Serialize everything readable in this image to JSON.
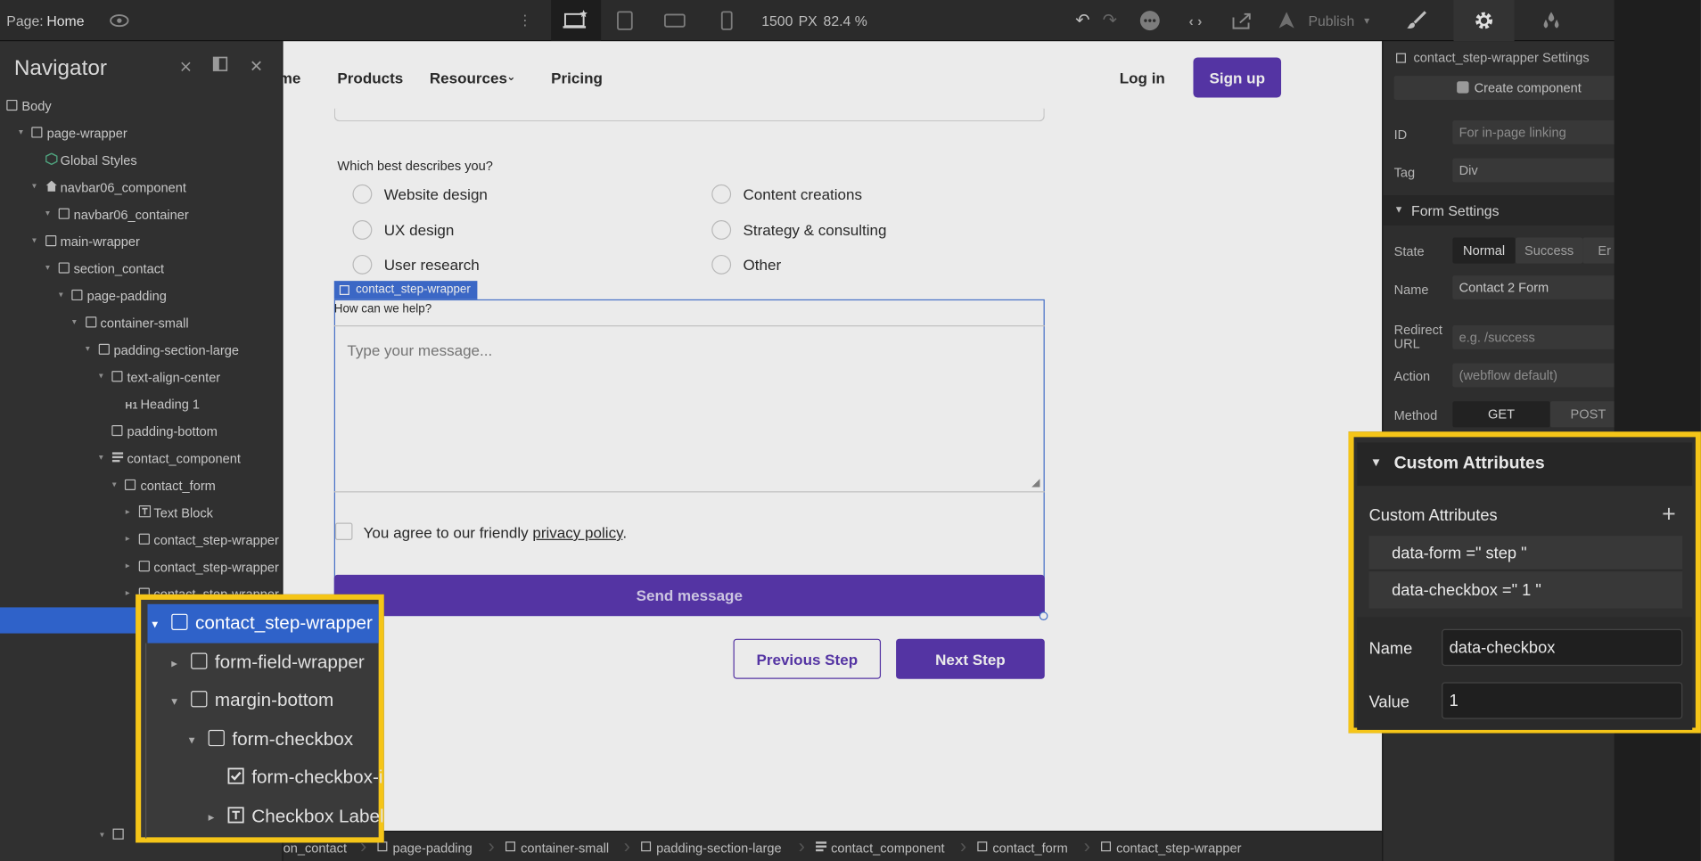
{
  "topbar": {
    "page_label": "Page:",
    "page_name": "Home",
    "width_value": "1500",
    "width_unit": "PX",
    "zoom": "82.4 %",
    "publish": "Publish"
  },
  "navigator": {
    "title": "Navigator",
    "tree": [
      {
        "label": "Body",
        "depth": 0,
        "arrow": false,
        "icon": "box"
      },
      {
        "label": "page-wrapper",
        "depth": 1,
        "arrow": true,
        "icon": "box"
      },
      {
        "label": "Global Styles",
        "depth": 2,
        "arrow": false,
        "icon": "cube"
      },
      {
        "label": "navbar06_component",
        "depth": 2,
        "arrow": true,
        "icon": "home"
      },
      {
        "label": "navbar06_container",
        "depth": 3,
        "arrow": true,
        "icon": "box"
      },
      {
        "label": "main-wrapper",
        "depth": 2,
        "arrow": true,
        "icon": "box"
      },
      {
        "label": "section_contact",
        "depth": 3,
        "arrow": true,
        "icon": "box"
      },
      {
        "label": "page-padding",
        "depth": 4,
        "arrow": true,
        "icon": "box"
      },
      {
        "label": "container-small",
        "depth": 5,
        "arrow": true,
        "icon": "box"
      },
      {
        "label": "padding-section-large",
        "depth": 6,
        "arrow": true,
        "icon": "box"
      },
      {
        "label": "text-align-center",
        "depth": 7,
        "arrow": true,
        "icon": "box"
      },
      {
        "label": "Heading 1",
        "depth": 8,
        "arrow": false,
        "icon": "h1"
      },
      {
        "label": "padding-bottom",
        "depth": 7,
        "arrow": false,
        "icon": "box"
      },
      {
        "label": "contact_component",
        "depth": 7,
        "arrow": true,
        "icon": "lines"
      },
      {
        "label": "contact_form",
        "depth": 8,
        "arrow": true,
        "icon": "box"
      },
      {
        "label": "Text Block",
        "depth": 9,
        "arrow": true,
        "icon": "text"
      },
      {
        "label": "contact_step-wrapper",
        "depth": 9,
        "arrow": true,
        "icon": "box"
      },
      {
        "label": "contact_step-wrapper",
        "depth": 9,
        "arrow": true,
        "icon": "box"
      },
      {
        "label": "contact_step-wrapper",
        "depth": 9,
        "arrow": true,
        "icon": "box"
      }
    ]
  },
  "nav_zoom": {
    "items": [
      {
        "label": "contact_step-wrapper"
      },
      {
        "label": "form-field-wrapper"
      },
      {
        "label": "margin-bottom"
      },
      {
        "label": "form-checkbox"
      },
      {
        "label": "form-checkbox-i"
      },
      {
        "label": "Checkbox Label"
      }
    ]
  },
  "site": {
    "nav": {
      "home": "me",
      "products": "Products",
      "resources": "Resources",
      "pricing": "Pricing",
      "login": "Log in",
      "signup": "Sign up"
    },
    "question": "Which best describes you?",
    "options": [
      {
        "label": "Website design"
      },
      {
        "label": "Content creations"
      },
      {
        "label": "UX design"
      },
      {
        "label": "Strategy & consulting"
      },
      {
        "label": "User research"
      },
      {
        "label": "Other"
      }
    ],
    "selection_tag": "contact_step-wrapper",
    "help_label": "How can we help?",
    "message_placeholder": "Type your message...",
    "agree_text": "You agree to our friendly",
    "privacy_link": "privacy policy",
    "agree_end": ".",
    "send": "Send message",
    "prev": "Previous Step",
    "next": "Next Step"
  },
  "breadcrumb": [
    "on_contact",
    "page-padding",
    "container-small",
    "padding-section-large",
    "contact_component",
    "contact_form",
    "contact_step-wrapper"
  ],
  "settings": {
    "title": "contact_step-wrapper Settings",
    "create_component": "Create component",
    "id_label": "ID",
    "id_placeholder": "For in-page linking",
    "tag_label": "Tag",
    "tag_value": "Div",
    "form_settings": "Form Settings",
    "state_label": "State",
    "states": [
      "Normal",
      "Success",
      "Er"
    ],
    "name_label": "Name",
    "name_value": "Contact 2 Form",
    "redirect_label": "Redirect URL",
    "redirect_placeholder": "e.g. /success",
    "action_label": "Action",
    "action_placeholder": "(webflow default)",
    "method_label": "Method",
    "methods": [
      "GET",
      "POST"
    ]
  },
  "custom_attributes": {
    "header": "Custom Attributes",
    "list_label": "Custom Attributes",
    "attrs": [
      "data-form =\" step \"",
      "data-checkbox =\" 1 \""
    ],
    "name_label": "Name",
    "name_value": "data-checkbox",
    "value_label": "Value",
    "value_value": "1"
  },
  "colors": {
    "accent": "#5a36b0",
    "highlight": "#f5c518",
    "selection": "#2f62c9"
  }
}
